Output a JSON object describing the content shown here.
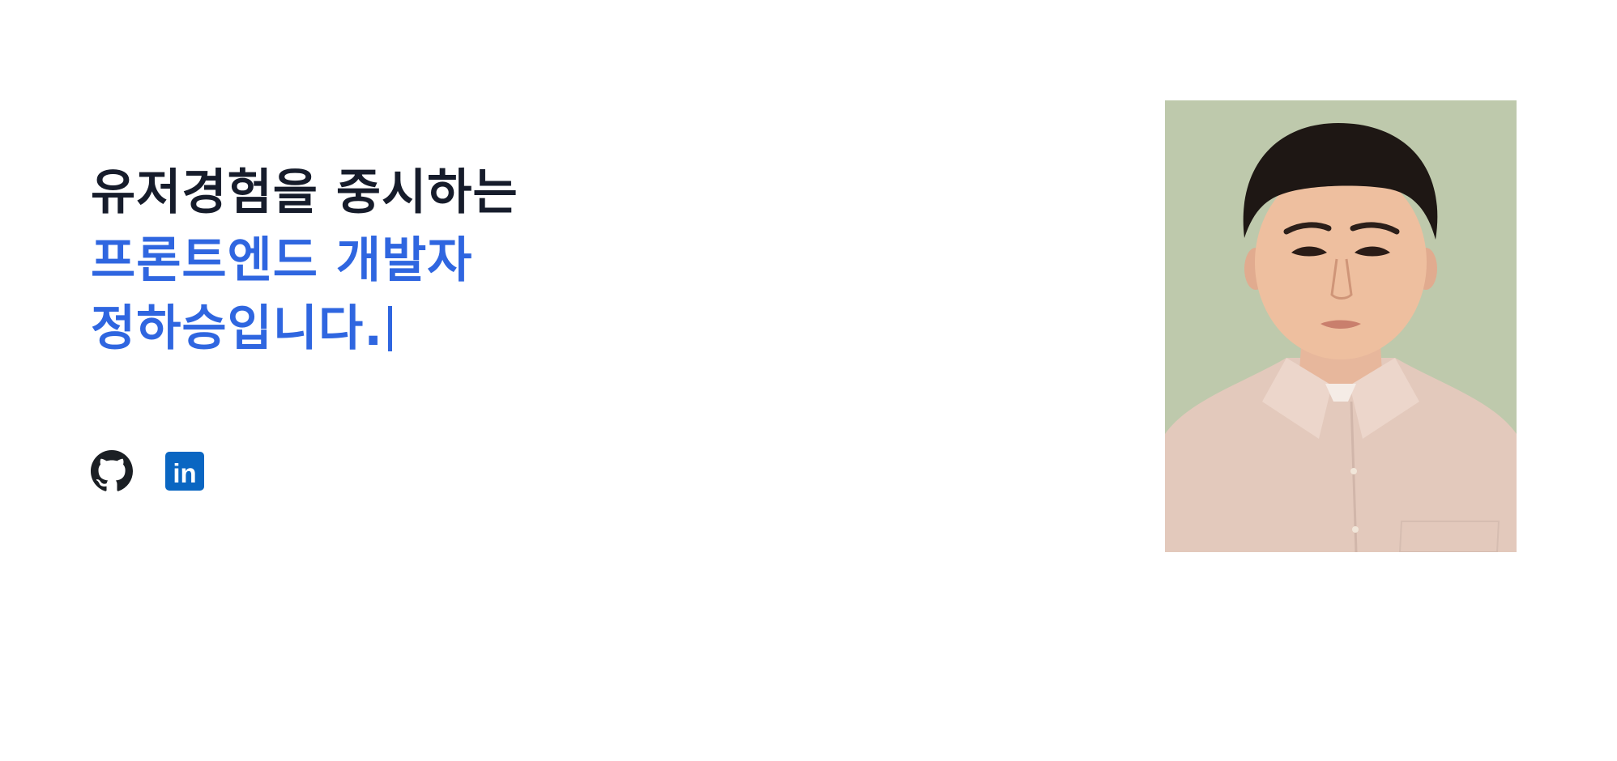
{
  "hero": {
    "headline": {
      "line1": "유저경험을 중시하는",
      "line2": "프론트엔드 개발자",
      "line3": "정하승입니다."
    },
    "colors": {
      "heading_dark": "#161c2b",
      "accent": "#2f66e0",
      "github": "#1b1f24",
      "linkedin": "#0a66c2",
      "photo_background": "#bec9ac"
    }
  },
  "socials": [
    {
      "icon": "github-icon"
    },
    {
      "icon": "linkedin-icon",
      "text": "in"
    }
  ]
}
